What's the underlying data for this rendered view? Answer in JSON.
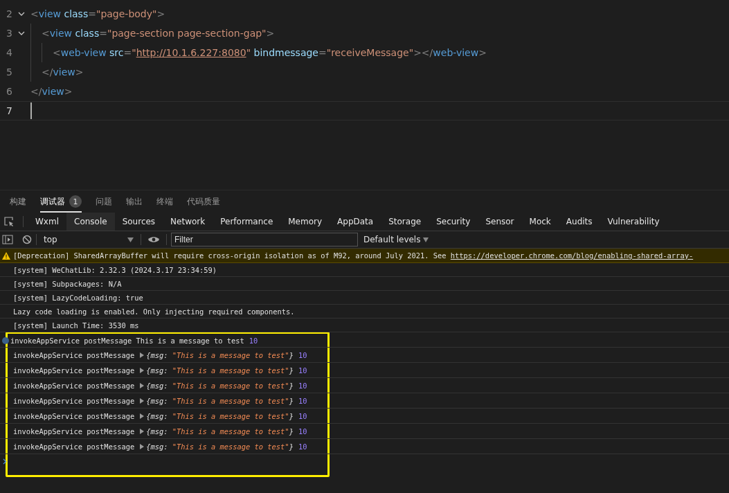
{
  "editor": {
    "lines": [
      {
        "number": "2",
        "foldable": true,
        "current": false,
        "tokens": [
          {
            "kind": "punct",
            "text": "<"
          },
          {
            "kind": "tag",
            "text": "view"
          },
          {
            "kind": "attr",
            "text": " class"
          },
          {
            "kind": "punct",
            "text": "="
          },
          {
            "kind": "string",
            "text": "\"page-body\""
          },
          {
            "kind": "punct",
            "text": ">"
          }
        ]
      },
      {
        "number": "3",
        "foldable": true,
        "current": false,
        "tokens": [
          {
            "kind": "punct",
            "text": "<"
          },
          {
            "kind": "tag",
            "text": "view"
          },
          {
            "kind": "attr",
            "text": " class"
          },
          {
            "kind": "punct",
            "text": "="
          },
          {
            "kind": "string",
            "text": "\"page-section page-section-gap\""
          },
          {
            "kind": "punct",
            "text": ">"
          }
        ]
      },
      {
        "number": "4",
        "foldable": false,
        "current": false,
        "tokens": [
          {
            "kind": "punct",
            "text": "<"
          },
          {
            "kind": "tag",
            "text": "web-view"
          },
          {
            "kind": "attr",
            "text": " src"
          },
          {
            "kind": "punct",
            "text": "="
          },
          {
            "kind": "string",
            "text": "\""
          },
          {
            "kind": "link",
            "text": "http://10.1.6.227:8080"
          },
          {
            "kind": "string",
            "text": "\""
          },
          {
            "kind": "attr",
            "text": " bindmessage"
          },
          {
            "kind": "punct",
            "text": "="
          },
          {
            "kind": "string",
            "text": "\"receiveMessage\""
          },
          {
            "kind": "punct_close",
            "text": "></"
          },
          {
            "kind": "tag",
            "text": "web-view"
          },
          {
            "kind": "punct",
            "text": ">"
          }
        ]
      },
      {
        "number": "5",
        "foldable": false,
        "current": false,
        "tokens": [
          {
            "kind": "punct_close",
            "text": "</"
          },
          {
            "kind": "tag",
            "text": "view"
          },
          {
            "kind": "punct",
            "text": ">"
          }
        ]
      },
      {
        "number": "6",
        "foldable": false,
        "current": false,
        "tokens": [
          {
            "kind": "punct_close",
            "text": "</"
          },
          {
            "kind": "tag",
            "text": "view"
          },
          {
            "kind": "punct",
            "text": ">"
          }
        ]
      },
      {
        "number": "7",
        "foldable": false,
        "current": true
      }
    ]
  },
  "panel_tabs": [
    {
      "label": "构建",
      "selected": false
    },
    {
      "label": "调试器",
      "selected": true,
      "badge": "1"
    },
    {
      "label": "问题",
      "selected": false
    },
    {
      "label": "输出",
      "selected": false
    },
    {
      "label": "终端",
      "selected": false
    },
    {
      "label": "代码质量",
      "selected": false
    }
  ],
  "devtools_tabs": [
    {
      "label": "Wxml",
      "selected": false
    },
    {
      "label": "Console",
      "selected": true
    },
    {
      "label": "Sources",
      "selected": false
    },
    {
      "label": "Network",
      "selected": false
    },
    {
      "label": "Performance",
      "selected": false
    },
    {
      "label": "Memory",
      "selected": false
    },
    {
      "label": "AppData",
      "selected": false
    },
    {
      "label": "Storage",
      "selected": false
    },
    {
      "label": "Security",
      "selected": false
    },
    {
      "label": "Sensor",
      "selected": false
    },
    {
      "label": "Mock",
      "selected": false
    },
    {
      "label": "Audits",
      "selected": false
    },
    {
      "label": "Vulnerability",
      "selected": false
    }
  ],
  "console_toolbar": {
    "context": "top",
    "filter_placeholder": "Filter",
    "levels": "Default levels"
  },
  "logs": [
    {
      "kind": "warning",
      "text": "[Deprecation] SharedArrayBuffer will require cross-origin isolation as of M92, around July 2021. See ",
      "link": "https://developer.chrome.com/blog/enabling-shared-array-"
    },
    {
      "kind": "plain",
      "text": "[system] WeChatLib: 2.32.3 (2024.3.17 23:34:59)"
    },
    {
      "kind": "plain",
      "text": "[system] Subpackages: N/A"
    },
    {
      "kind": "plain",
      "text": "[system] LazyCodeLoading: true"
    },
    {
      "kind": "plain",
      "text": "Lazy code loading is enabled. Only injecting required components."
    },
    {
      "kind": "plain",
      "text": "[system] Launch Time: 3530 ms"
    }
  ],
  "highlighted_logs": [
    {
      "kind": "info",
      "text": "invokeAppService postMessage This is a message to test",
      "count": "10"
    },
    {
      "kind": "object",
      "text": "invokeAppService postMessage",
      "object": "{msg: ",
      "value": "\"This is a message to test\"",
      "close": "}",
      "count": "10"
    },
    {
      "kind": "object",
      "text": "invokeAppService postMessage",
      "object": "{msg: ",
      "value": "\"This is a message to test\"",
      "close": "}",
      "count": "10"
    },
    {
      "kind": "object",
      "text": "invokeAppService postMessage",
      "object": "{msg: ",
      "value": "\"This is a message to test\"",
      "close": "}",
      "count": "10"
    },
    {
      "kind": "object",
      "text": "invokeAppService postMessage",
      "object": "{msg: ",
      "value": "\"This is a message to test\"",
      "close": "}",
      "count": "10"
    },
    {
      "kind": "object",
      "text": "invokeAppService postMessage",
      "object": "{msg: ",
      "value": "\"This is a message to test\"",
      "close": "}",
      "count": "10"
    },
    {
      "kind": "object",
      "text": "invokeAppService postMessage",
      "object": "{msg: ",
      "value": "\"This is a message to test\"",
      "close": "}",
      "count": "10"
    },
    {
      "kind": "object",
      "text": "invokeAppService postMessage",
      "object": "{msg: ",
      "value": "\"This is a message to test\"",
      "close": "}",
      "count": "10"
    }
  ]
}
